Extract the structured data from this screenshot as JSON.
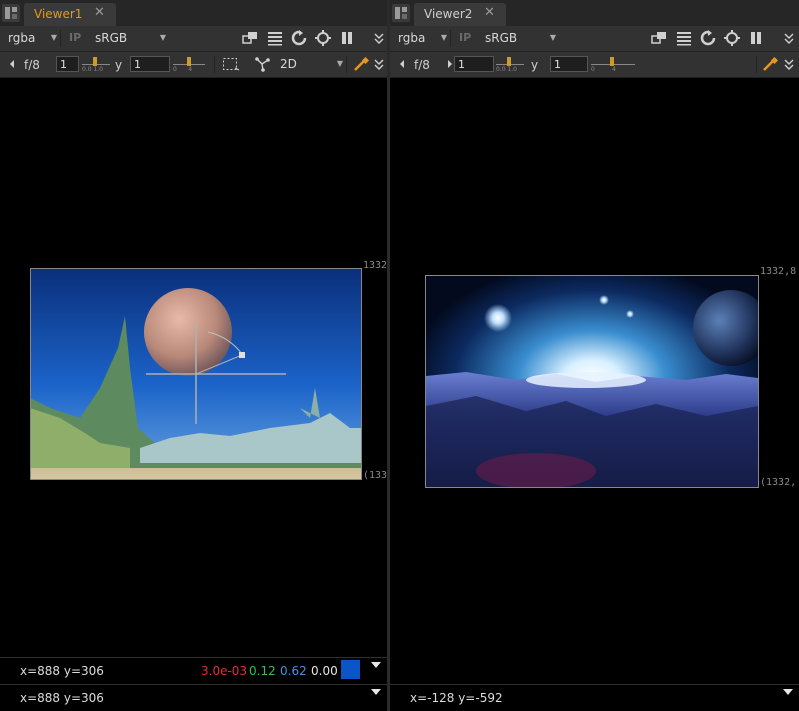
{
  "viewer1": {
    "tab_label": "Viewer1",
    "close_glyph": "✕",
    "channels": "rgba",
    "input_process": "IP",
    "colorspace": "sRGB",
    "fstop": "f/8",
    "gain_value": "1",
    "gamma_label": "y",
    "gamma_value": "1",
    "view_mode": "2D",
    "format_label_top": "1332",
    "format_label_bottom": "(133",
    "status_coords": "x=888 y=306",
    "pixel_r": "3.0e-03",
    "pixel_g": "0.12",
    "pixel_b": "0.62",
    "pixel_a": "0.00",
    "swatch_color": "#0a55c8",
    "status_coords_2": "x=888 y=306"
  },
  "viewer2": {
    "tab_label": "Viewer2",
    "close_glyph": "✕",
    "channels": "rgba",
    "input_process": "IP",
    "colorspace": "sRGB",
    "fstop": "f/8",
    "gain_value": "1",
    "gamma_label": "y",
    "gamma_value": "1",
    "format_label_top": "1332,8",
    "format_label_bottom": "(1332,",
    "status_coords": "x=-128 y=-592"
  },
  "colors": {
    "active_tab": "#e8961e",
    "inactive_tab": "#cfcfcf",
    "red_value": "#e03030",
    "green_value": "#32c050",
    "blue_value": "#4f8fe0"
  },
  "icons": [
    "menu-icon",
    "close-icon",
    "wipe-icon",
    "lut-icon",
    "refresh-icon",
    "roi-icon",
    "pause-icon",
    "expand-icon",
    "prev-icon",
    "next-icon",
    "crop-icon",
    "transform-icon",
    "pick-icon"
  ]
}
